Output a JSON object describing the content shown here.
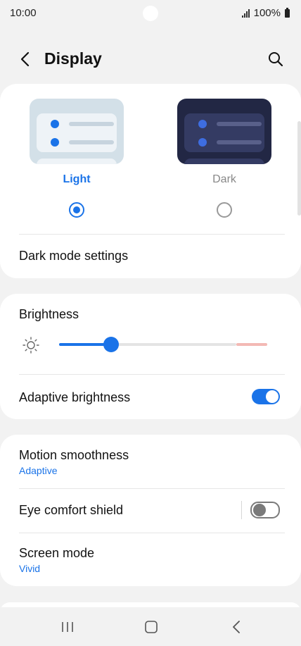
{
  "status": {
    "time": "10:00",
    "battery": "100%"
  },
  "header": {
    "title": "Display"
  },
  "theme": {
    "light_label": "Light",
    "dark_label": "Dark",
    "selected": "Light"
  },
  "dark_mode_settings": {
    "label": "Dark mode settings"
  },
  "brightness": {
    "label": "Brightness",
    "level": 0.25
  },
  "adaptive_brightness": {
    "label": "Adaptive brightness",
    "enabled": true
  },
  "motion_smoothness": {
    "label": "Motion smoothness",
    "value": "Adaptive"
  },
  "eye_comfort": {
    "label": "Eye comfort shield",
    "enabled": false
  },
  "screen_mode": {
    "label": "Screen mode",
    "value": "Vivid"
  },
  "colors": {
    "accent": "#1a73e8",
    "background": "#f2f2f2",
    "card": "#ffffff"
  },
  "icons": [
    "back-arrow-icon",
    "search-icon",
    "sun-icon",
    "recent-apps-icon",
    "home-icon",
    "nav-back-icon"
  ]
}
